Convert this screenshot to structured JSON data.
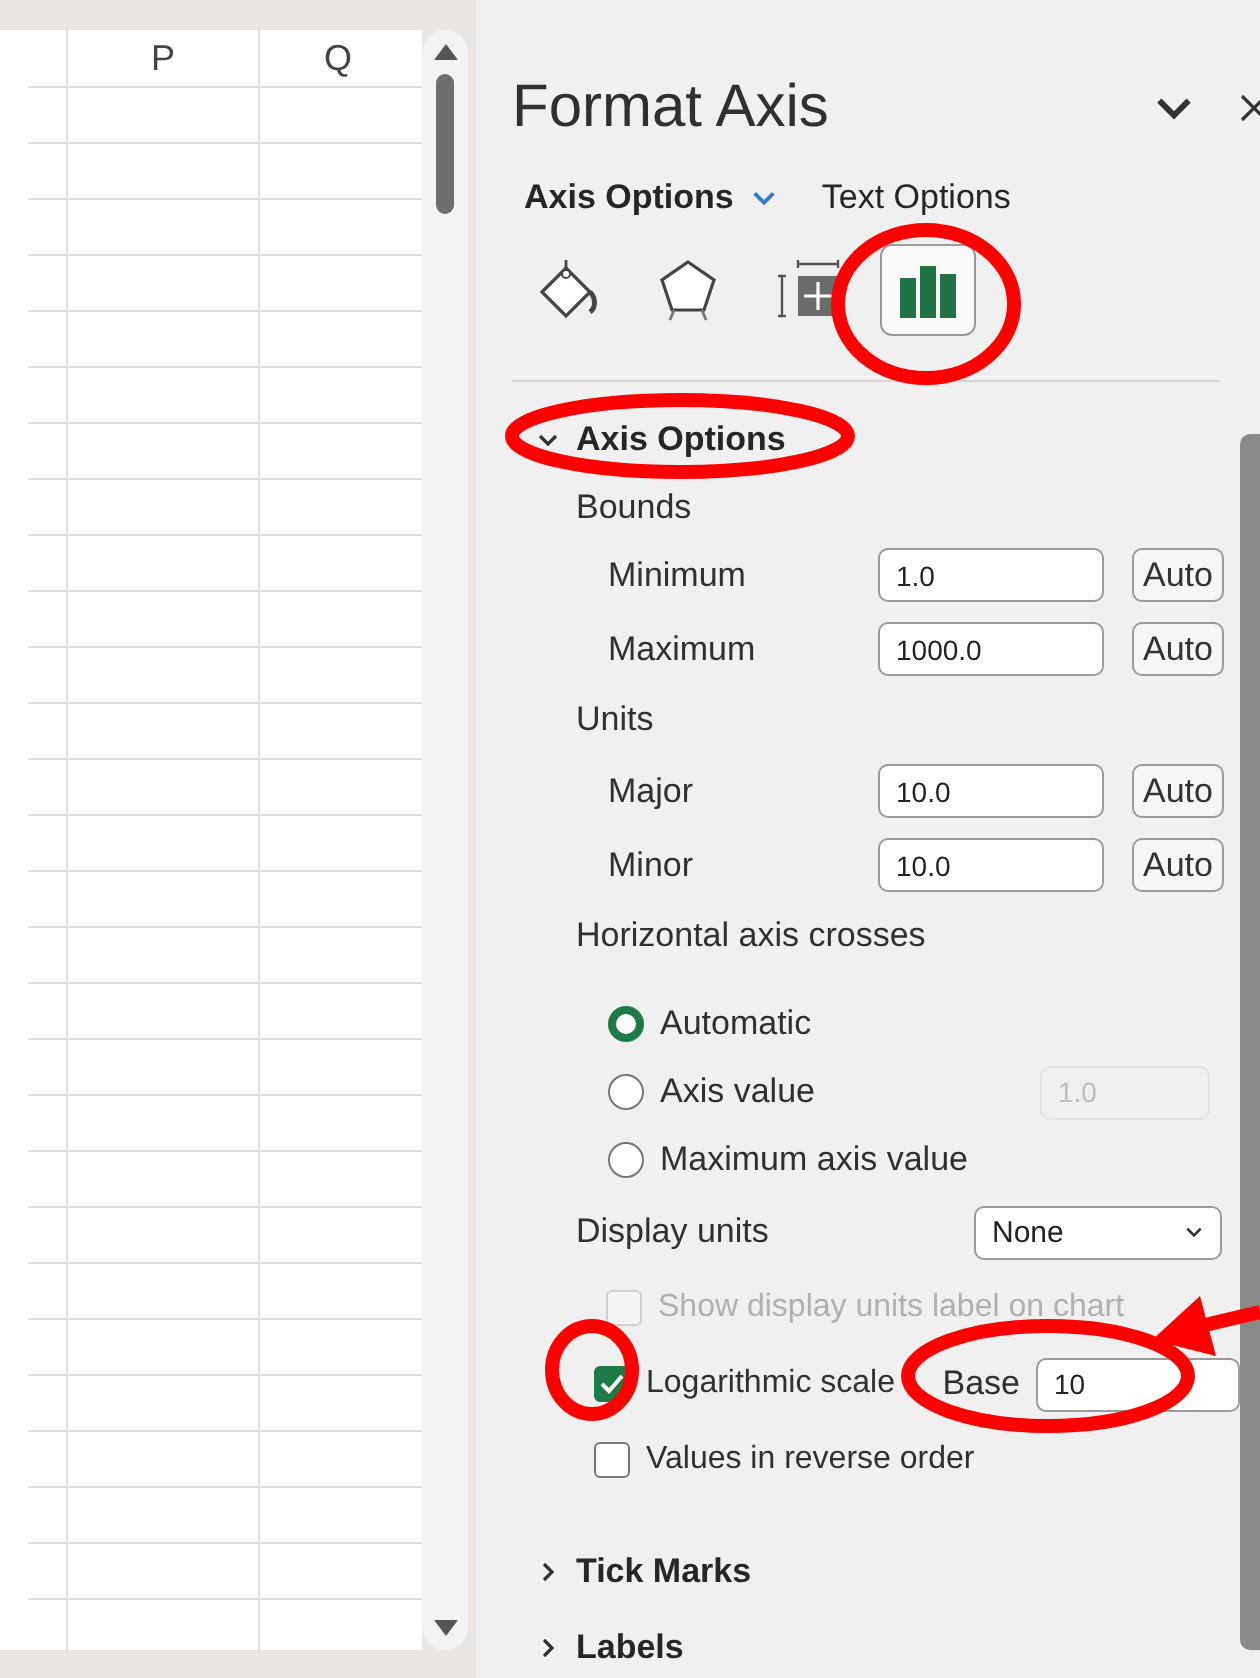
{
  "sheet": {
    "columns": [
      "P",
      "Q"
    ]
  },
  "pane": {
    "title": "Format Axis",
    "tabs": [
      {
        "label": "Axis Options",
        "selected": true
      },
      {
        "label": "Text Options",
        "selected": false
      }
    ],
    "icon_tabs": [
      {
        "kind": "fill",
        "selected": false
      },
      {
        "kind": "effects",
        "selected": false
      },
      {
        "kind": "size",
        "selected": false
      },
      {
        "kind": "chart",
        "selected": true
      }
    ],
    "sections": [
      {
        "title": "Axis Options",
        "expanded": true
      },
      {
        "title": "Tick Marks",
        "expanded": false
      },
      {
        "title": "Labels",
        "expanded": false
      }
    ],
    "axis_options": {
      "bounds_label": "Bounds",
      "bounds": [
        {
          "label": "Minimum",
          "value": "1.0",
          "button": "Auto"
        },
        {
          "label": "Maximum",
          "value": "1000.0",
          "button": "Auto"
        }
      ],
      "units_label": "Units",
      "units": [
        {
          "label": "Major",
          "value": "10.0",
          "button": "Auto"
        },
        {
          "label": "Minor",
          "value": "10.0",
          "button": "Auto"
        }
      ],
      "crosses_label": "Horizontal axis crosses",
      "crosses": [
        {
          "label": "Automatic",
          "selected": true
        },
        {
          "label": "Axis value",
          "selected": false,
          "value": "1.0"
        },
        {
          "label": "Maximum axis value",
          "selected": false
        }
      ],
      "display_units": {
        "label": "Display units",
        "value": "None"
      },
      "options": [
        {
          "label": "Show display units label on chart",
          "checked": false,
          "disabled": true
        },
        {
          "label": "Logarithmic scale",
          "checked": true,
          "disabled": false,
          "base": {
            "label": "Base",
            "value": "10"
          }
        },
        {
          "label": "Values in reverse order",
          "checked": false,
          "disabled": false
        }
      ]
    }
  }
}
